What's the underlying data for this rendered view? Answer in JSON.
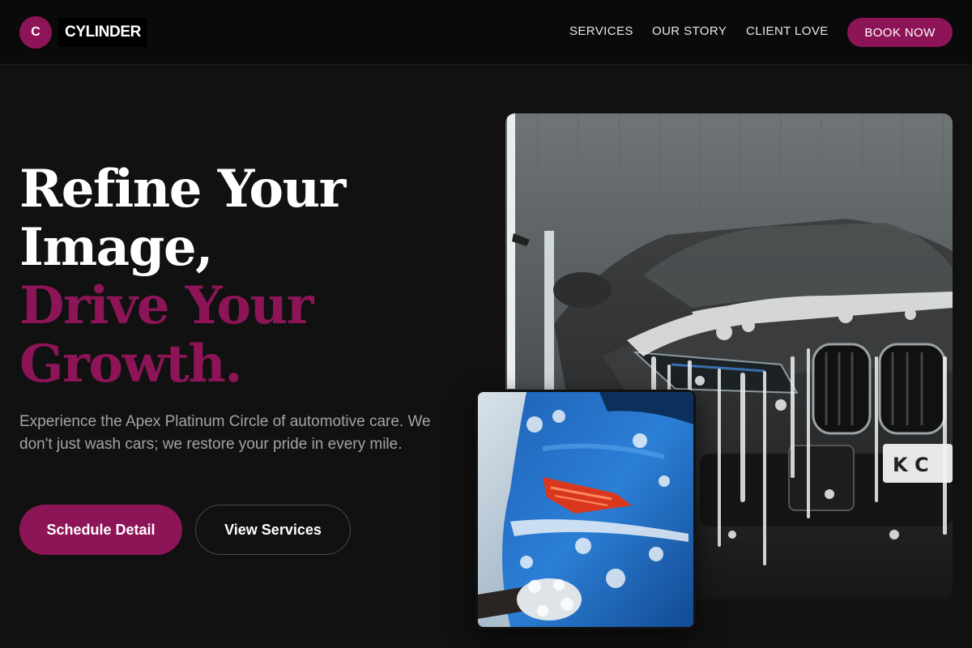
{
  "brand": {
    "mark_letter": "C",
    "name": "CYLINDER"
  },
  "nav": {
    "links": [
      "SERVICES",
      "OUR STORY",
      "CLIENT LOVE"
    ],
    "cta_label": "BOOK NOW"
  },
  "hero": {
    "headline_lines": [
      "Refine Your",
      "Image,",
      "Drive Your",
      "Growth."
    ],
    "description": "Experience the Apex Platinum Circle of automotive care. We don't just wash cars; we restore your pride in every mile.",
    "primary_button": "Schedule Detail",
    "secondary_button": "View Services"
  },
  "images": {
    "main_plate_text": "K C"
  },
  "colors": {
    "accent": "#8d1557",
    "background": "#111111",
    "header_bg": "#0a0a0a",
    "body_text": "#a4a4a4"
  }
}
